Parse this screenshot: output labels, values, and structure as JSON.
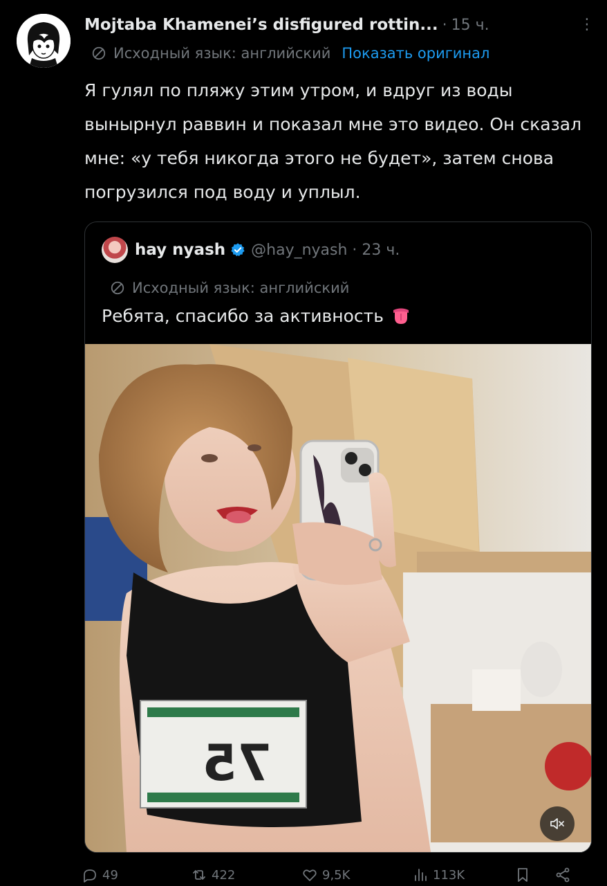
{
  "post": {
    "author_name": "Mojtaba Khamenei’s disfigured rottin...",
    "time": "15 ч.",
    "source_language": "Исходный язык: английский",
    "show_original": "Показать оригинал",
    "text": "Я гулял по пляжу этим утром, и вдруг из воды вынырнул раввин и показал мне это видео. Он сказал мне: «у тебя никогда этого не будет», затем снова погрузился под воду и уплыл."
  },
  "quote": {
    "name": "hay nyash",
    "handle": "@hay_nyash",
    "time": "23 ч.",
    "source_language": "Исходный язык: английский",
    "text": "Ребята, спасибо за активность"
  },
  "actions": {
    "replies": "49",
    "reposts": "422",
    "likes": "9,5K",
    "views": "113K"
  },
  "icons": {
    "translate": "translate-icon",
    "verified": "verified-badge-icon",
    "more": "more-icon",
    "mute": "muted-volume-icon",
    "reply": "reply-icon",
    "repost": "repost-icon",
    "like": "heart-icon",
    "views": "views-icon",
    "bookmark": "bookmark-icon",
    "share": "share-icon"
  },
  "colors": {
    "background": "#000000",
    "text": "#e7e9ea",
    "muted": "#71767b",
    "link": "#1d9bf0"
  }
}
